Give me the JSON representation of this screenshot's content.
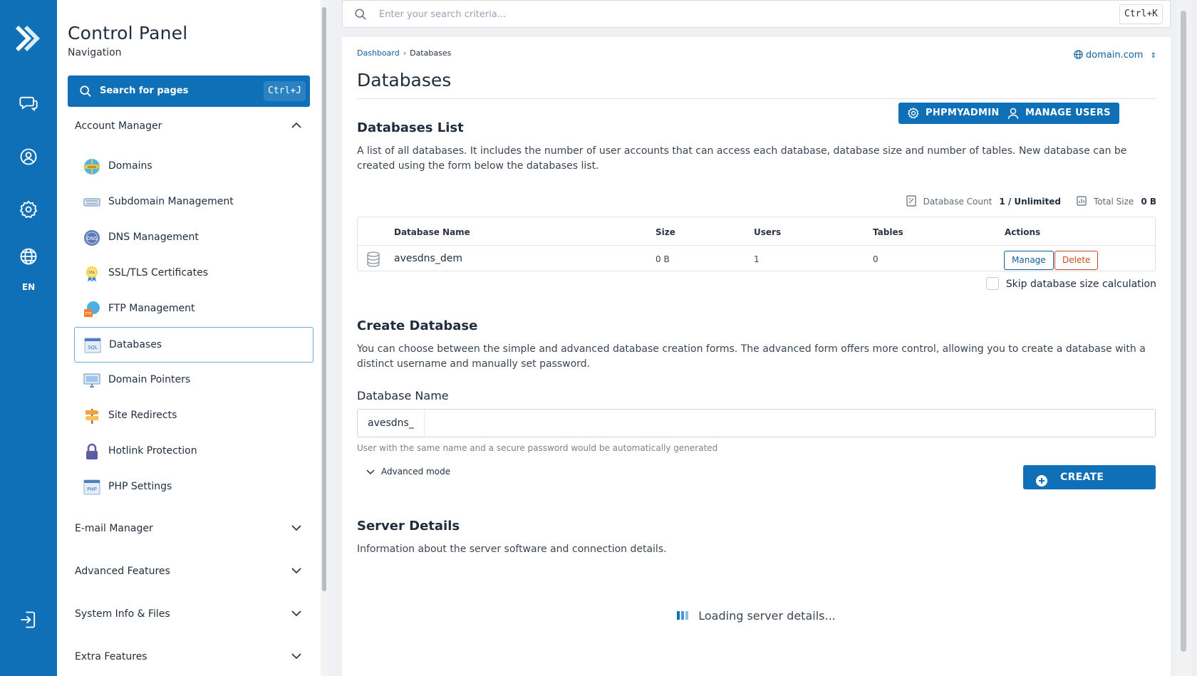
{
  "rail": {
    "icons": [
      "logo-icon",
      "chat-icon",
      "user-icon",
      "settings-icon",
      "globe-icon",
      "logout-icon"
    ],
    "lang": "EN"
  },
  "nav": {
    "title": "Control Panel",
    "subtitle": "Navigation",
    "search_label": "Search for pages",
    "search_shortcut": "Ctrl+J",
    "account_section": "Account Manager",
    "items": [
      {
        "label": "Domains",
        "icon": "www-globe-icon"
      },
      {
        "label": "Subdomain Management",
        "icon": "subdomain-icon"
      },
      {
        "label": "DNS Management",
        "icon": "dns-icon"
      },
      {
        "label": "SSL/TLS Certificates",
        "icon": "ssl-badge-icon"
      },
      {
        "label": "FTP Management",
        "icon": "ftp-icon"
      },
      {
        "label": "Databases",
        "icon": "sql-icon"
      },
      {
        "label": "Domain Pointers",
        "icon": "monitor-icon"
      },
      {
        "label": "Site Redirects",
        "icon": "signpost-icon"
      },
      {
        "label": "Hotlink Protection",
        "icon": "lock-icon"
      },
      {
        "label": "PHP Settings",
        "icon": "php-icon"
      }
    ],
    "sections": [
      "E-mail Manager",
      "Advanced Features",
      "System Info & Files",
      "Extra Features"
    ]
  },
  "topsearch": {
    "placeholder": "Enter your search criteria...",
    "shortcut": "Ctrl+K"
  },
  "breadcrumb": {
    "home": "Dashboard",
    "current": "Databases"
  },
  "domain_selector": "domain.com",
  "page_title": "Databases",
  "buttons": {
    "phpmyadmin": "PHPMYADMIN",
    "manage_users": "MANAGE USERS"
  },
  "databases_list": {
    "heading": "Databases List",
    "description": "A list of all databases. It includes the number of user accounts that can access each database, database size and number of tables. New database can be created using the form below the databases list.",
    "count_label": "Database Count",
    "count_value": "1 / Unlimited",
    "size_label": "Total Size",
    "size_value": "0 B",
    "columns": [
      "Database Name",
      "Size",
      "Users",
      "Tables",
      "Actions"
    ],
    "rows": [
      {
        "name": "avesdns_dem",
        "size": "0 B",
        "users": "1",
        "tables": "0"
      }
    ],
    "manage_label": "Manage",
    "delete_label": "Delete",
    "skip_label": "Skip database size calculation"
  },
  "create_database": {
    "heading": "Create Database",
    "description": "You can choose between the simple and advanced database creation forms. The advanced form offers more control, allowing you to create a database with a distinct username and manually set password.",
    "field_label": "Database Name",
    "prefix": "avesdns_",
    "value": "",
    "hint": "User with the same name and a secure password would be automatically generated",
    "advanced_label": "Advanced mode",
    "create_label": "CREATE"
  },
  "server_details": {
    "heading": "Server Details",
    "description": "Information about the server software and connection details.",
    "loading": "Loading server details..."
  },
  "colors": {
    "primary": "#0f70b7",
    "delete": "#c9491d",
    "rail": "#0f70b7"
  }
}
